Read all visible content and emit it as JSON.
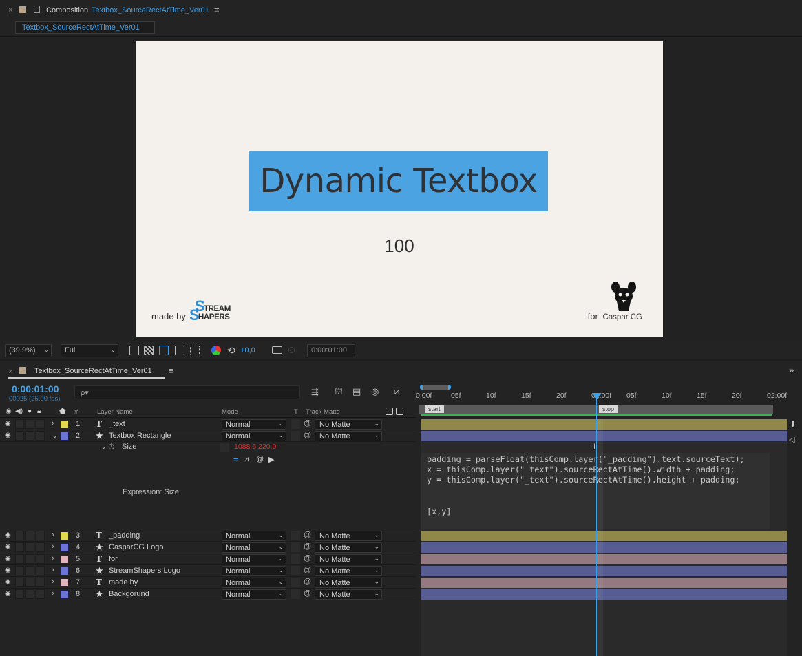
{
  "comp_header": {
    "close": "×",
    "label": "Composition",
    "comp_name": "Textbox_SourceRectAtTime_Ver01",
    "menu": "≡"
  },
  "comp_tab": "Textbox_SourceRectAtTime_Ver01",
  "canvas": {
    "title": "Dynamic Textbox",
    "padding_value": "100",
    "made_by": "made by",
    "ss_logo_line1": "TREAM",
    "ss_logo_line2": "HAPERS",
    "for_label": "for",
    "cg_label": "Caspar CG"
  },
  "viewer_toolbar": {
    "zoom": "(39,9%)",
    "resolution": "Full",
    "exposure": "+0,0",
    "time": "0:00:01:00"
  },
  "timeline": {
    "tab_label": "Textbox_SourceRectAtTime_Ver01",
    "timecode": "0:00:01:00",
    "frames": "00025 (25.00 fps)",
    "search_placeholder": "ρ▾",
    "columns": {
      "hash": "#",
      "layer_name": "Layer Name",
      "mode": "Mode",
      "t": "T",
      "track_matte": "Track Matte"
    },
    "ruler_ticks": [
      "0:00f",
      "05f",
      "10f",
      "15f",
      "20f",
      "01:00f",
      "05f",
      "10f",
      "15f",
      "20f",
      "02:00f"
    ],
    "markers": {
      "start": "start",
      "stop": "stop"
    },
    "layers": [
      {
        "num": "1",
        "type": "T",
        "name": "_text",
        "mode": "Normal",
        "matte": "No Matte",
        "color": "#e3d94f",
        "bar": "#8f8848"
      },
      {
        "num": "2",
        "type": "★",
        "name": "Textbox Rectangle",
        "mode": "Normal",
        "matte": "No Matte",
        "color": "#6c74d6",
        "bar": "#575c92"
      },
      {
        "num": "3",
        "type": "T",
        "name": "_padding",
        "mode": "Normal",
        "matte": "No Matte",
        "color": "#e3d94f",
        "bar": "#8f8848"
      },
      {
        "num": "4",
        "type": "★",
        "name": "CasparCG Logo",
        "mode": "Normal",
        "matte": "No Matte",
        "color": "#6c74d6",
        "bar": "#575c92"
      },
      {
        "num": "5",
        "type": "T",
        "name": "for",
        "mode": "Normal",
        "matte": "No Matte",
        "color": "#e2b4bd",
        "bar": "#947a80"
      },
      {
        "num": "6",
        "type": "★",
        "name": "StreamShapers Logo",
        "mode": "Normal",
        "matte": "No Matte",
        "color": "#6c74d6",
        "bar": "#575c92"
      },
      {
        "num": "7",
        "type": "T",
        "name": "made by",
        "mode": "Normal",
        "matte": "No Matte",
        "color": "#e2b4bd",
        "bar": "#947a80"
      },
      {
        "num": "8",
        "type": "★",
        "name": "Backgorund",
        "mode": "Normal",
        "matte": "No Matte",
        "color": "#6c74d6",
        "bar": "#575c92"
      }
    ],
    "size_prop": {
      "label": "Size",
      "value": "1088,6,220,0"
    },
    "expression_label": "Expression: Size",
    "expression_code": [
      "padding = parseFloat(thisComp.layer(\"_padding\").text.sourceText);",
      "x = thisComp.layer(\"_text\").sourceRectAtTime().width + padding;",
      "y = thisComp.layer(\"_text\").sourceRectAtTime().height + padding;",
      "[x,y]"
    ]
  },
  "colors": {
    "accent": "#3ea4ee",
    "title_box": "#4ba3e2",
    "canvas_bg": "#f4f0eb",
    "work_area_green": "#39b34a",
    "expression_value": "#e03030"
  }
}
